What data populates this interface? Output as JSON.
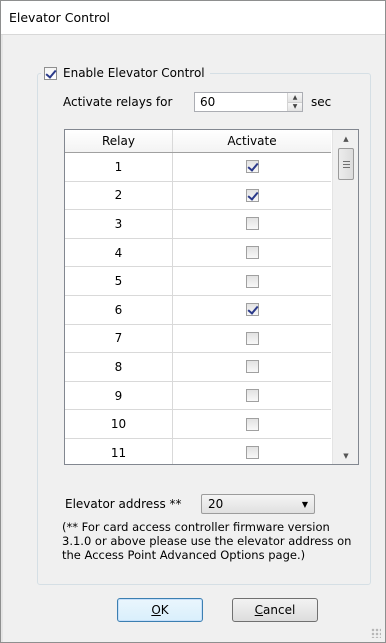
{
  "window": {
    "title": "Elevator Control"
  },
  "group": {
    "enable_label": "Enable Elevator Control",
    "enabled": true
  },
  "relays": {
    "label": "Activate relays for",
    "value": "60",
    "unit": "sec"
  },
  "grid": {
    "columns": [
      "Relay",
      "Activate"
    ],
    "rows": [
      {
        "relay": "1",
        "activate": true
      },
      {
        "relay": "2",
        "activate": true
      },
      {
        "relay": "3",
        "activate": false
      },
      {
        "relay": "4",
        "activate": false
      },
      {
        "relay": "5",
        "activate": false
      },
      {
        "relay": "6",
        "activate": true
      },
      {
        "relay": "7",
        "activate": false
      },
      {
        "relay": "8",
        "activate": false
      },
      {
        "relay": "9",
        "activate": false
      },
      {
        "relay": "10",
        "activate": false
      },
      {
        "relay": "11",
        "activate": false
      }
    ]
  },
  "address": {
    "label": "Elevator address **",
    "value": "20",
    "note": "(** For card access controller firmware version 3.1.0 or above please use the elevator address on the Access Point Advanced Options page.)"
  },
  "buttons": {
    "ok": "OK",
    "cancel": "Cancel"
  },
  "icons": {
    "spin_up": "spin-up-icon",
    "spin_down": "spin-down-icon",
    "scroll_up": "scroll-up-arrow-icon",
    "scroll_down": "scroll-down-arrow-icon",
    "combo": "chevron-down-icon",
    "resize": "resize-grip-icon"
  }
}
